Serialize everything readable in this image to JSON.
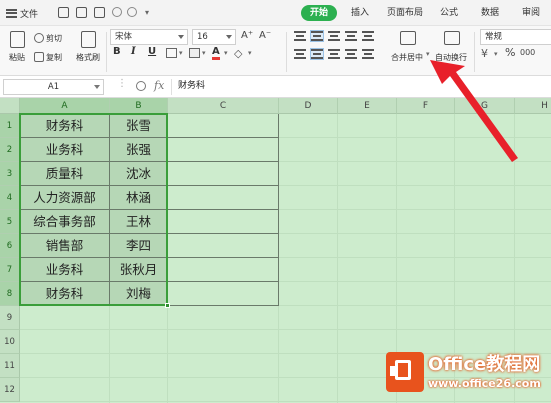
{
  "ribbon": {
    "menu_label": "文件",
    "tabs": [
      "开始",
      "插入",
      "页面布局",
      "公式",
      "数据",
      "审阅"
    ],
    "active_tab": "开始"
  },
  "toolbar": {
    "paste_label": "粘贴",
    "cut_label": "剪切",
    "copy_label": "复制",
    "format_painter_label": "格式刷",
    "font_name": "宋体",
    "font_size": "16",
    "bold": "B",
    "italic": "I",
    "underline": "U",
    "font_color_label": "A",
    "merge_center_label": "合并居中",
    "wrap_text_label": "自动换行",
    "number_format": "常规",
    "percent": "%",
    "thousands": "000"
  },
  "formula_bar": {
    "name_box": "A1",
    "fx_label": "fx",
    "content": "财务科"
  },
  "sheet": {
    "columns": [
      "A",
      "B",
      "C",
      "D",
      "E",
      "F",
      "G",
      "H"
    ],
    "rows": [
      "1",
      "2",
      "3",
      "4",
      "5",
      "6",
      "7",
      "8",
      "9",
      "10",
      "11",
      "12"
    ],
    "data": [
      [
        "财务科",
        "张雪"
      ],
      [
        "业务科",
        "张强"
      ],
      [
        "质量科",
        "沈冰"
      ],
      [
        "人力资源部",
        "林涵"
      ],
      [
        "综合事务部",
        "王林"
      ],
      [
        "销售部",
        "李四"
      ],
      [
        "业务科",
        "张秋月"
      ],
      [
        "财务科",
        "刘梅"
      ]
    ],
    "grid_color": "#cdeccd",
    "selection_color": "#3a9e3a"
  },
  "watermark": {
    "title": "Office教程网",
    "url": "www.office26.com",
    "logo_color": "#e8531d"
  },
  "arrow_color": "#e8202a"
}
